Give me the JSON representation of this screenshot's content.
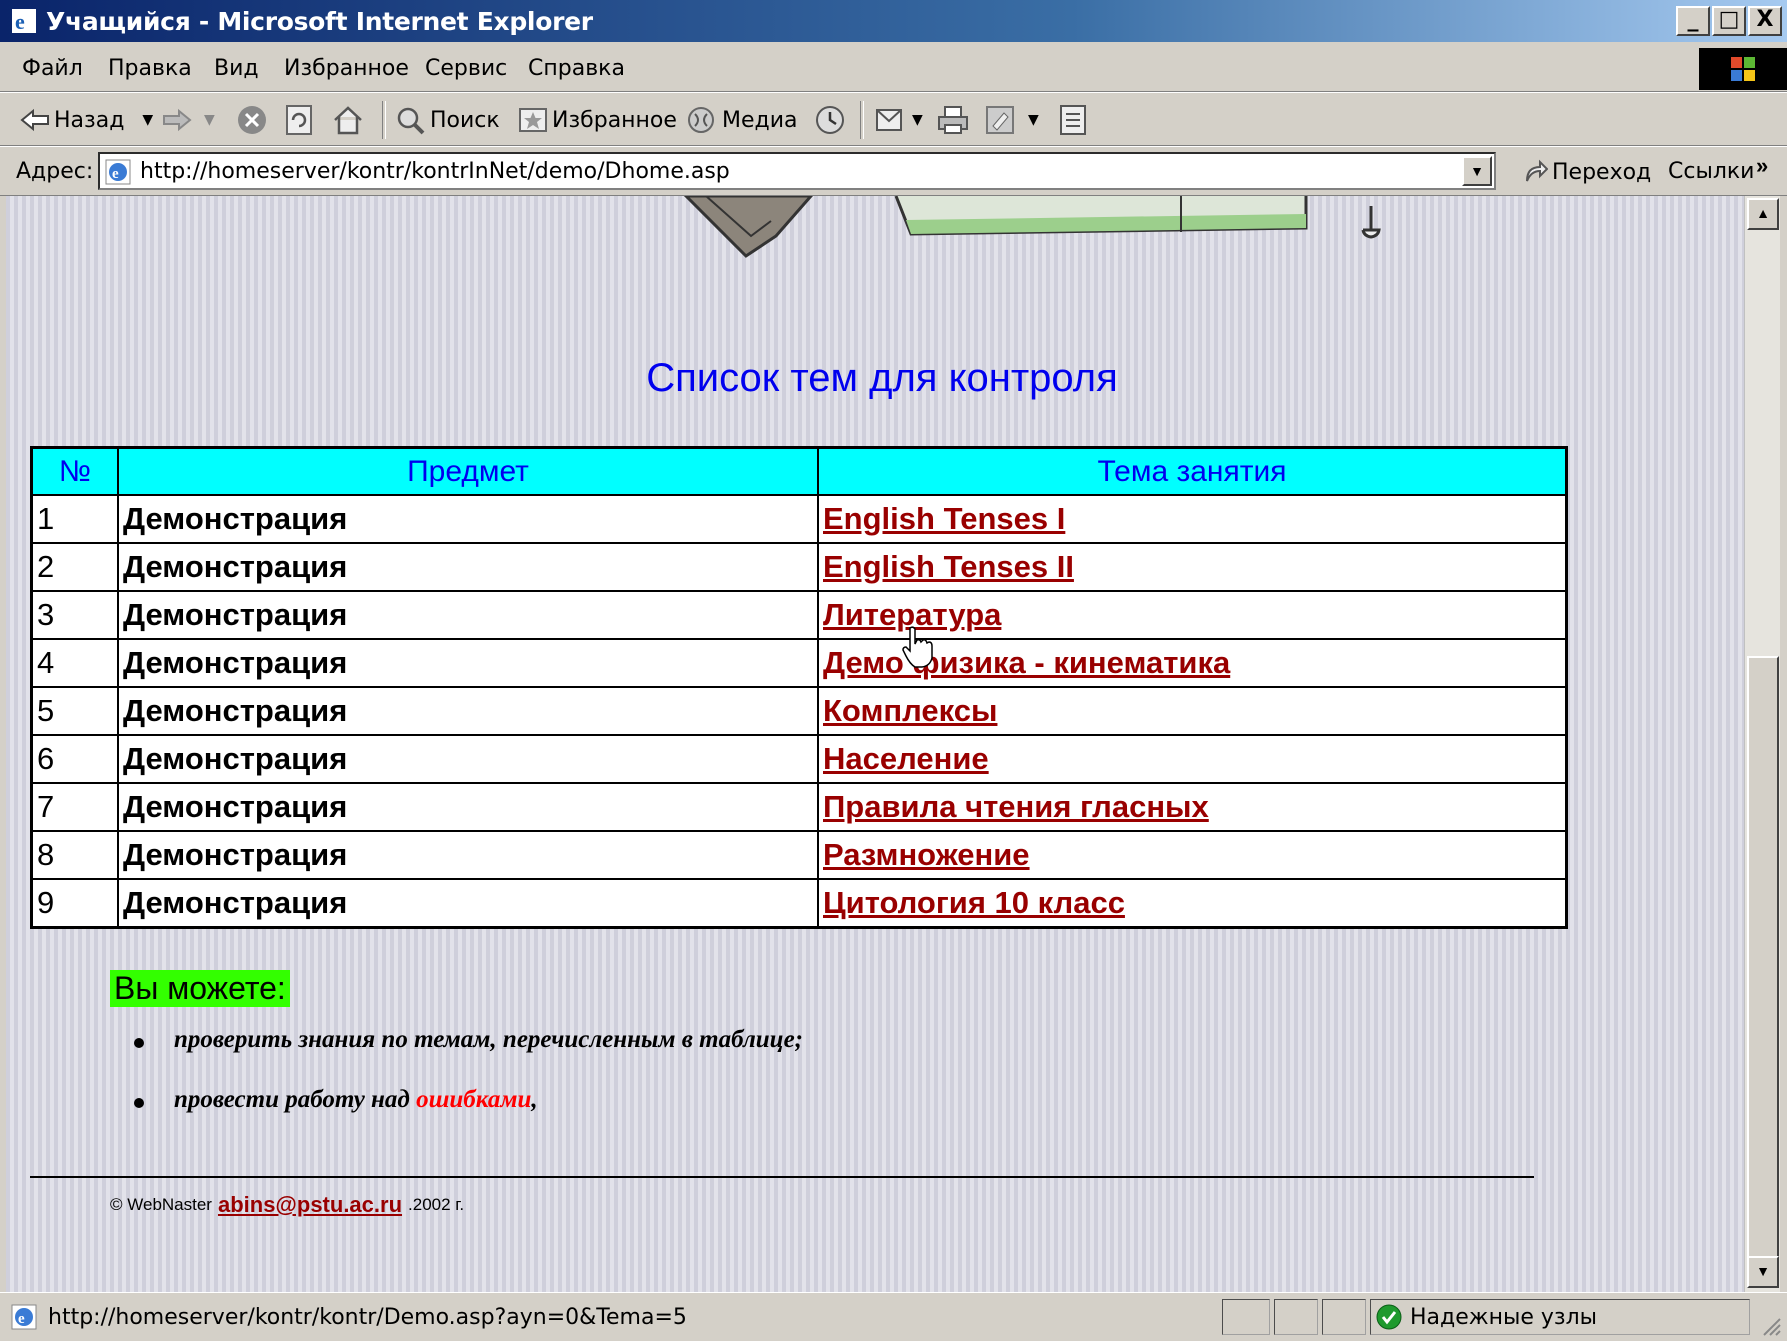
{
  "window": {
    "title": "Учащийся - Microsoft Internet Explorer",
    "min": "_",
    "max": "□",
    "close": "X"
  },
  "menu": [
    "Файл",
    "Правка",
    "Вид",
    "Избранное",
    "Сервис",
    "Справка"
  ],
  "toolbar": {
    "back": "Назад",
    "search": "Поиск",
    "favorites": "Избранное",
    "media": "Медиа"
  },
  "address": {
    "label": "Адрес:",
    "url": "http://homeserver/kontr/kontrInNet/demo/Dhome.asp",
    "go": "Переход",
    "links": "Ссылки",
    "more": "»"
  },
  "page": {
    "title": "Список тем для контроля",
    "table": {
      "headers": [
        "№",
        "Предмет",
        "Тема занятия"
      ],
      "rows": [
        {
          "num": "1",
          "subject": "Демонстрация",
          "topic": "English Tenses I"
        },
        {
          "num": "2",
          "subject": "Демонстрация",
          "topic": "English Tenses II"
        },
        {
          "num": "3",
          "subject": "Демонстрация",
          "topic": "Литература"
        },
        {
          "num": "4",
          "subject": "Демонстрация",
          "topic": "Демо физика - кинематика"
        },
        {
          "num": "5",
          "subject": "Демонстрация",
          "topic": "Комплексы"
        },
        {
          "num": "6",
          "subject": "Демонстрация",
          "topic": "Население"
        },
        {
          "num": "7",
          "subject": "Демонстрация",
          "topic": "Правила чтения гласных"
        },
        {
          "num": "8",
          "subject": "Демонстрация",
          "topic": "Размножение"
        },
        {
          "num": "9",
          "subject": "Демонстрация",
          "topic": "Цитология 10 класс"
        }
      ]
    },
    "hint_label": "Вы можете:",
    "bullet1": "проверить знания по темам, перечисленным в таблице;",
    "bullet2_prefix": "провести работу над",
    "bullet2_link": "ошибками",
    "bullet2_suffix": ",",
    "footer": {
      "prefix": "© WebNaster",
      "email": "abins@pstu.ac.ru",
      "suffix": ".2002 г."
    }
  },
  "status": {
    "url": "http://homeserver/kontr/kontr/Demo.asp?ayn=0&Tema=5",
    "zone": "Надежные узлы"
  },
  "colors": {
    "title_bar": "#0a246a",
    "header_bg": "#00ffff",
    "link": "#990000",
    "heading": "#0000ee",
    "hint_bg": "#33ff00",
    "error_link": "#ff0000"
  }
}
